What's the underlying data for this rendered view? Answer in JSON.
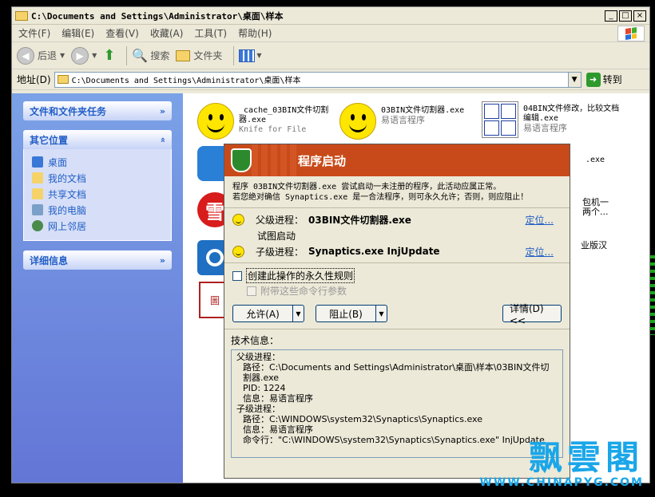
{
  "window": {
    "title": "C:\\Documents and Settings\\Administrator\\桌面\\样本",
    "controls": [
      "_",
      "□",
      "×"
    ]
  },
  "menu": [
    "文件(F)",
    "编辑(E)",
    "查看(V)",
    "收藏(A)",
    "工具(T)",
    "帮助(H)"
  ],
  "toolbar": {
    "back": "后退",
    "search": "搜索",
    "folders": "文件夹"
  },
  "address": {
    "label": "地址(D)",
    "value": "C:\\Documents and Settings\\Administrator\\桌面\\样本",
    "go": "转到"
  },
  "sidebar": {
    "tasks_title": "文件和文件夹任务",
    "places_title": "其它位置",
    "places": [
      "桌面",
      "我的文档",
      "共享文档",
      "我的电脑",
      "网上邻居"
    ],
    "details_title": "详细信息"
  },
  "files": [
    {
      "name": "_cache_03BIN文件切割器.exe",
      "desc": "Knife for File"
    },
    {
      "name": "03BIN文件切割器.exe",
      "desc": "易语言程序"
    },
    {
      "name": "04BIN文件修改，比较文档编辑.exe",
      "desc": "易语言程序"
    },
    {
      "partial1": ".exe",
      "partial2": "包机一",
      "partial3": "两个...",
      "partial4": "业版汉"
    }
  ],
  "icons": {
    "seal_text": "圖意\n隊啟",
    "red_text": "雪"
  },
  "dialog": {
    "title": "程序启动",
    "message_line1": "程序 03BIN文件切割器.exe 尝试启动一未注册的程序，此活动应属正常。",
    "message_line2": "若您绝对确信 Synaptics.exe 是一合法程序，则可永久允许；否则，则应阻止！",
    "parent_label": "父级进程：",
    "parent_value": "03BIN文件切割器.exe",
    "locate": "定位...",
    "tried": "试图启动",
    "child_label": "子级进程：",
    "child_value": "Synaptics.exe InjUpdate",
    "perm_rule": "创建此操作的永久性规则",
    "with_args": "附带这些命令行参数",
    "allow": "允许(A)",
    "block": "阻止(B)",
    "details": "详情(D) <<",
    "tech_label": "技术信息：",
    "tech": {
      "parent_head": "父级进程：",
      "parent_path": "路径：C:\\Documents and Settings\\Administrator\\桌面\\样本\\03BIN文件切割器.exe",
      "parent_pid": "PID: 1224",
      "parent_info": "信息：易语言程序",
      "child_head": "子级进程：",
      "child_path": "路径：C:\\WINDOWS\\system32\\Synaptics\\Synaptics.exe",
      "child_info": "信息：易语言程序",
      "child_cmd": "命令行：\"C:\\WINDOWS\\system32\\Synaptics\\Synaptics.exe\" InjUpdate"
    }
  },
  "watermark": {
    "title": "飘雲閣",
    "url": "WWW.CHINAPYG.COM"
  }
}
